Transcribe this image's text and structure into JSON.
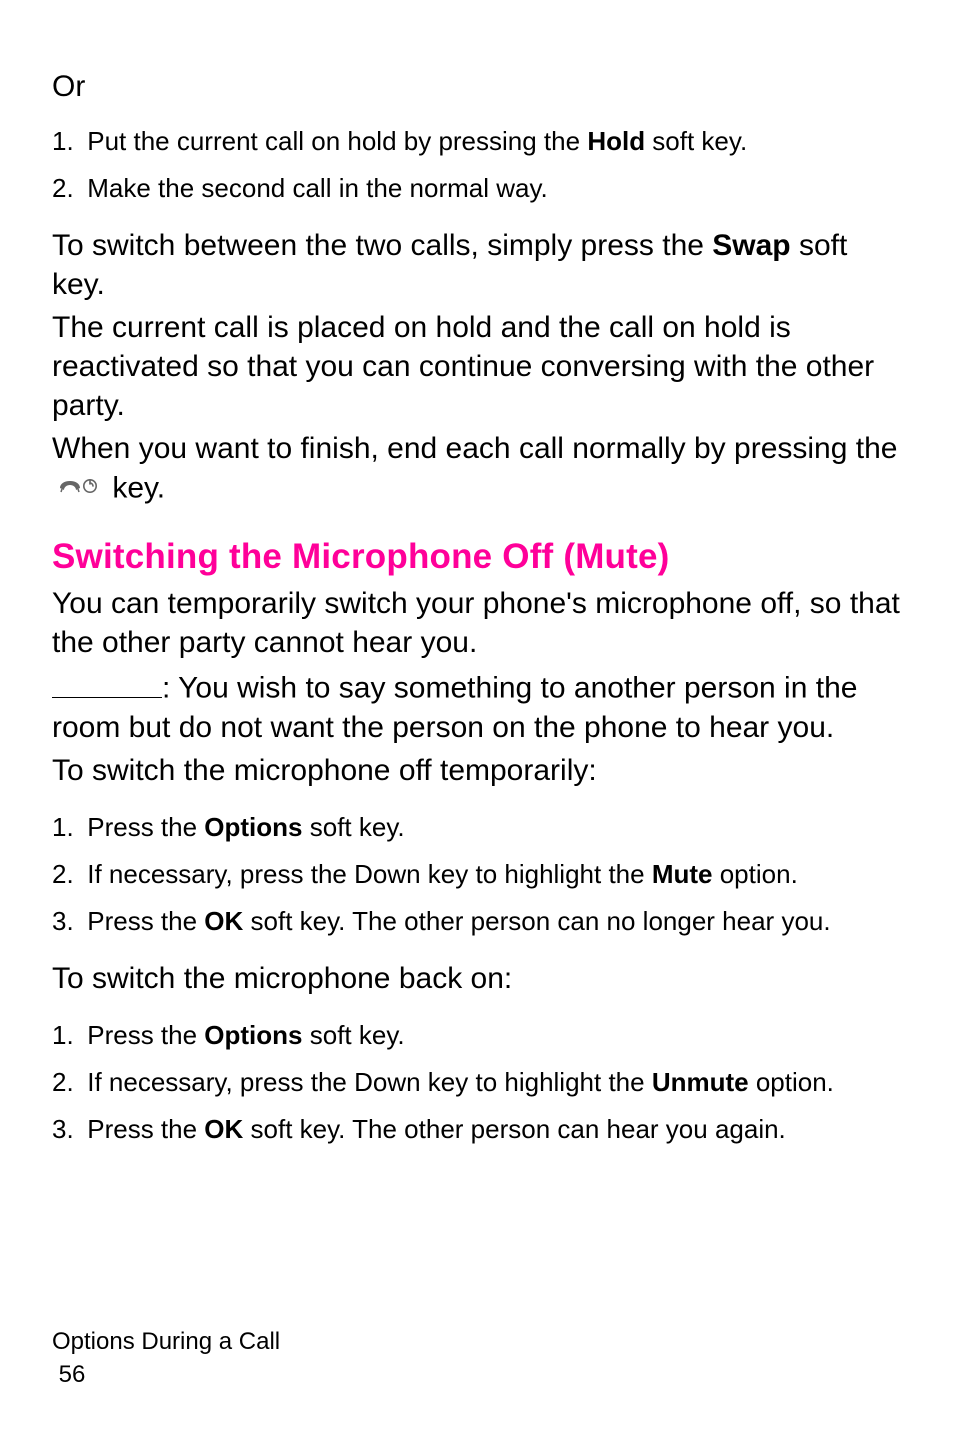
{
  "or": "Or",
  "list1": {
    "i1": {
      "num": "1.",
      "pre": "Put the current call on hold by pressing the ",
      "bold": "Hold",
      "post": " soft key."
    },
    "i2": {
      "num": "2.",
      "text": "Make the second call in the normal way."
    }
  },
  "para1": {
    "pre": "To switch between the two calls, simply press the ",
    "bold": "Swap",
    "post": " soft key."
  },
  "para2": "The current call is placed on hold and the call on hold is reactivated so that you can continue conversing with the other party.",
  "para3": {
    "pre": "When you want to finish, end each call normally by pressing the ",
    "post": " key."
  },
  "endKeyIconName": "end-call-key-icon",
  "heading": "Switching the Microphone Off (Mute)",
  "para4": "You can temporarily switch your phone's microphone off, so that the other party cannot hear you.",
  "example": ": You wish to say something to another person in the room but do not want the person on the phone to hear you.",
  "para5": "To switch the microphone off temporarily:",
  "list2": {
    "i1": {
      "num": "1.",
      "pre": "Press the ",
      "bold": "Options",
      "post": " soft key."
    },
    "i2": {
      "num": "2.",
      "pre": "If necessary, press the Down key to highlight the ",
      "bold": "Mute",
      "post": " option."
    },
    "i3": {
      "num": "3.",
      "pre": "Press the ",
      "bold": "OK",
      "post": " soft key. The other person can no longer hear you."
    }
  },
  "para6": "To switch the microphone back on:",
  "list3": {
    "i1": {
      "num": "1.",
      "pre": "Press the ",
      "bold": "Options",
      "post": " soft key."
    },
    "i2": {
      "num": "2.",
      "pre": "If necessary, press the Down key to highlight the ",
      "bold": "Unmute",
      "post": " option."
    },
    "i3": {
      "num": "3.",
      "pre": "Press the ",
      "bold": "OK",
      "post": " soft key. The other person can hear you again."
    }
  },
  "footer": {
    "title": "Options During a Call",
    "page": "56"
  }
}
